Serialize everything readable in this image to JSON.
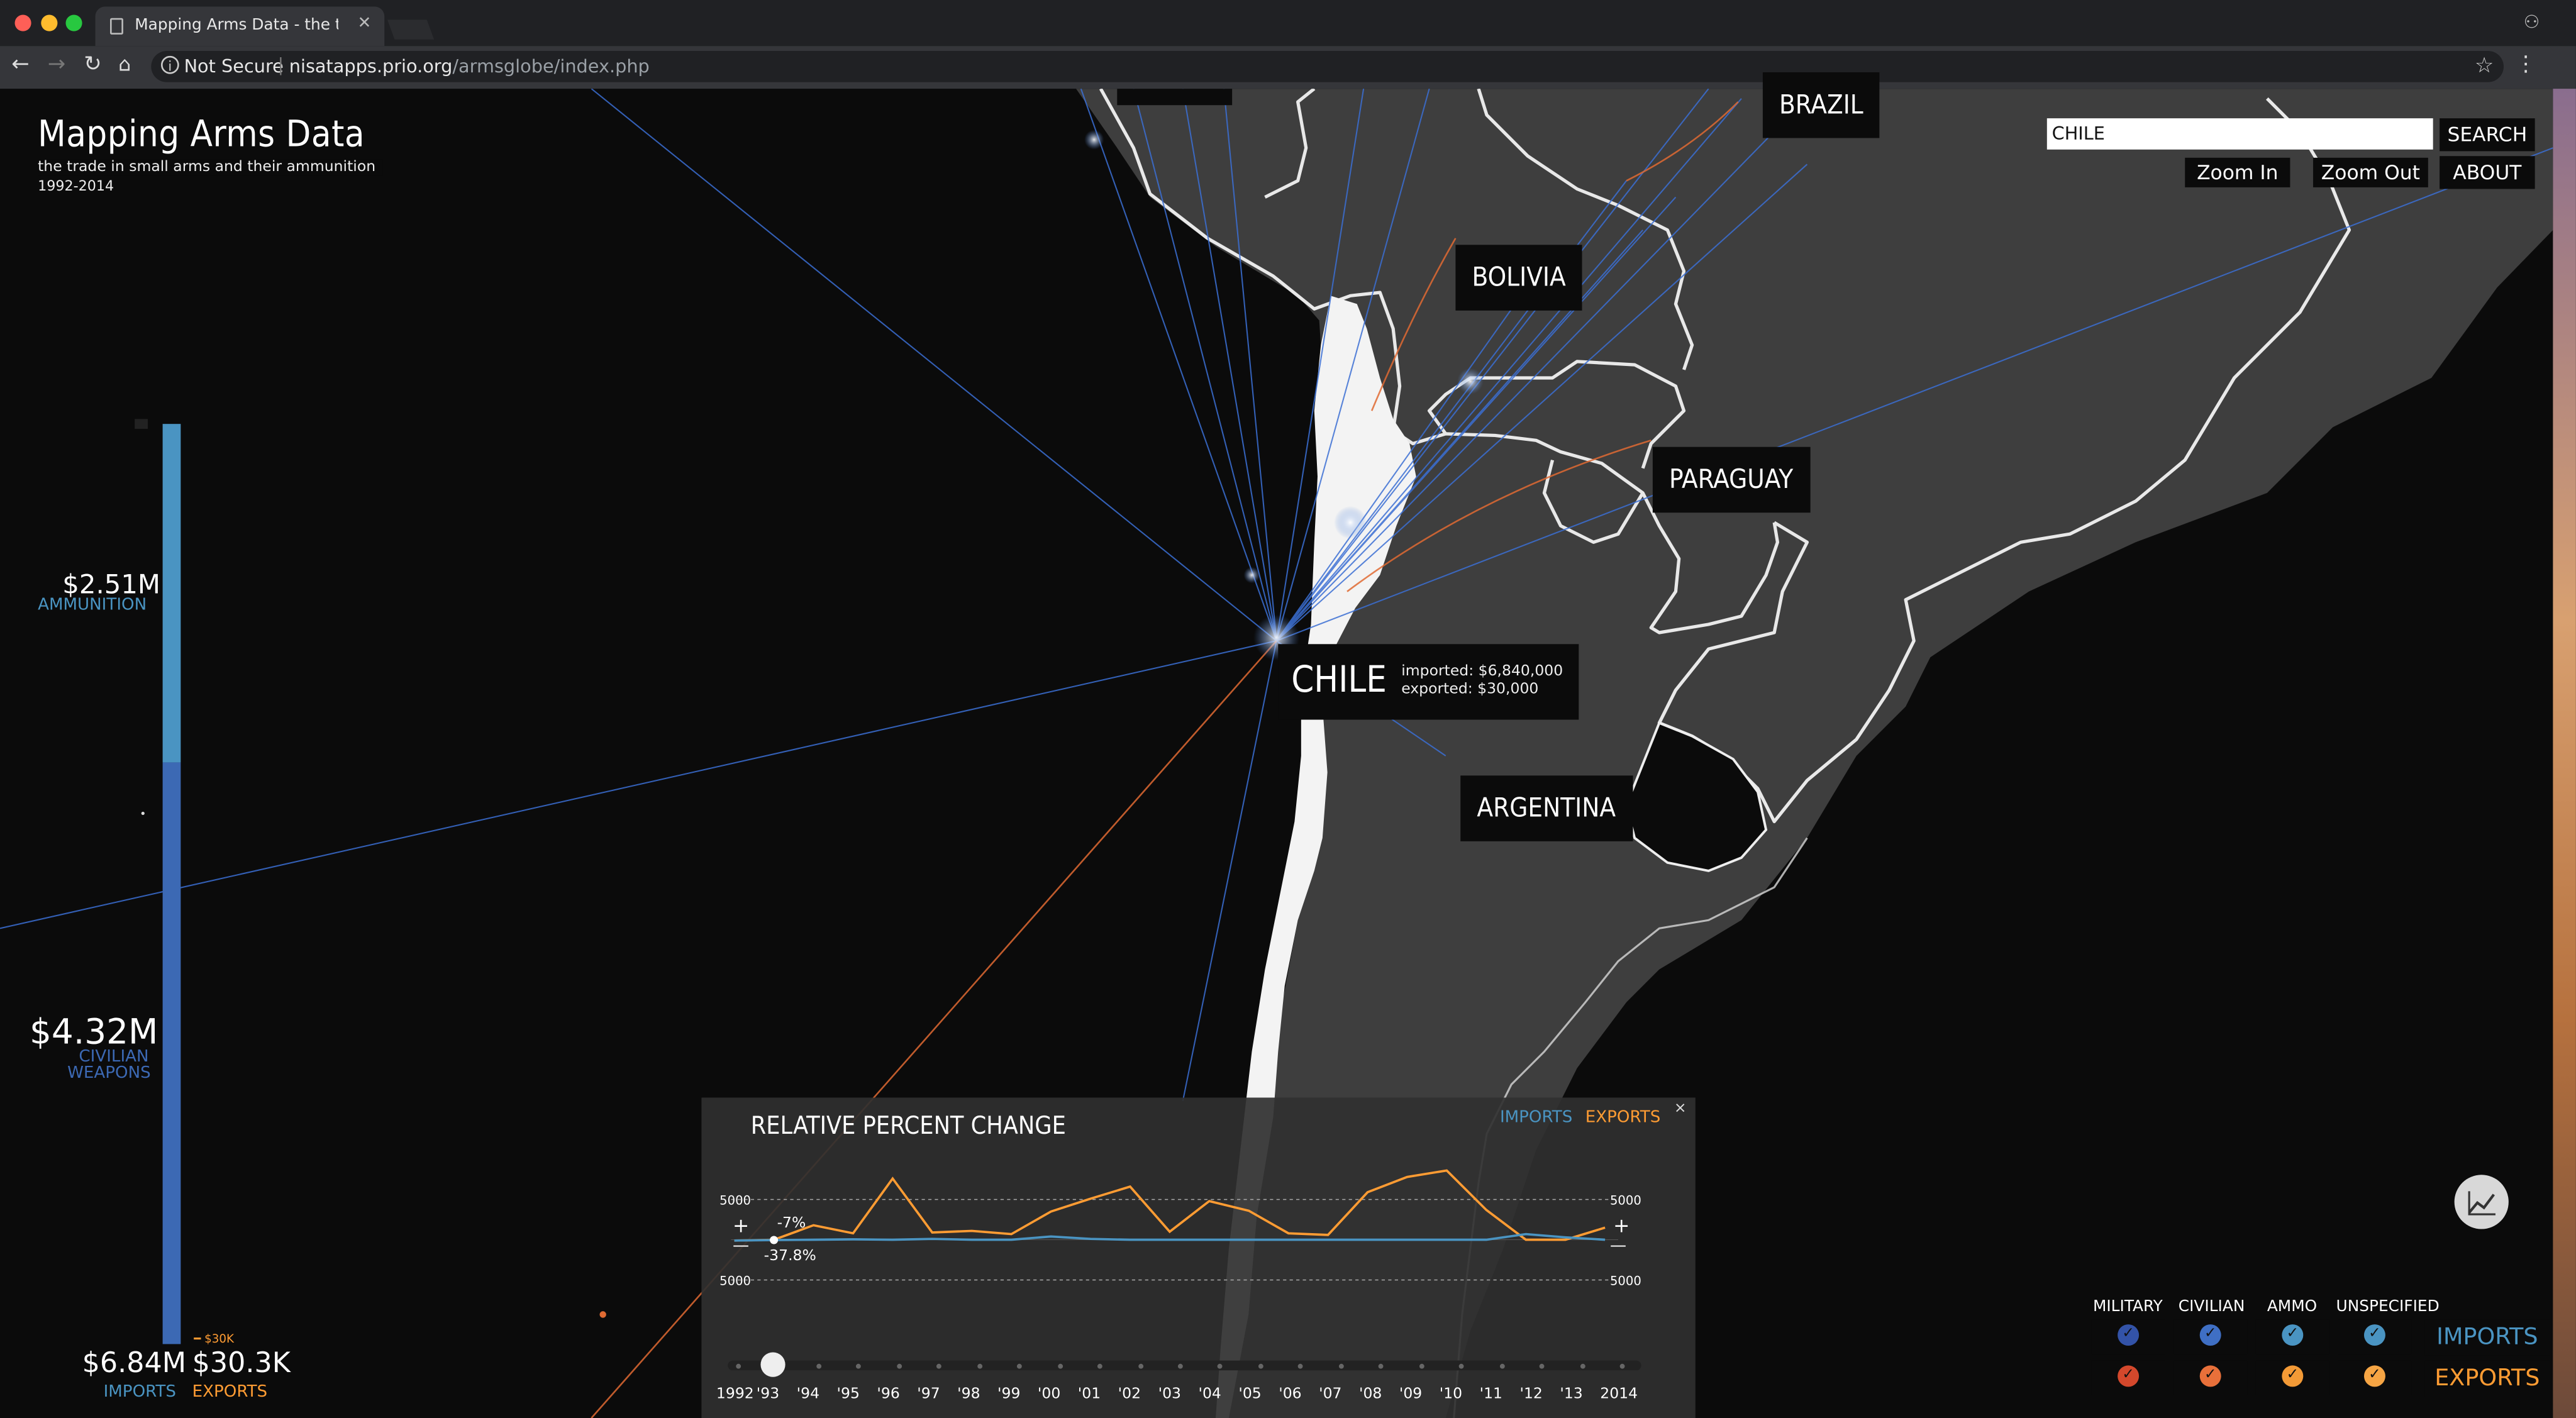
{
  "browser": {
    "tab_title": "Mapping Arms Data - the trad",
    "not_secure": "Not Secure",
    "url_host": "nisatapps.prio.org",
    "url_path": "/armsglobe/index.php"
  },
  "app": {
    "title": "Mapping Arms Data",
    "subtitle": "the trade in small arms and their ammunition",
    "years": "1992-2014"
  },
  "search": {
    "value": "CHILE",
    "button": "SEARCH"
  },
  "controls": {
    "zoom_in": "Zoom In",
    "zoom_out": "Zoom Out",
    "about": "ABOUT"
  },
  "countries": {
    "brazil": "BRAZIL",
    "bolivia": "BOLIVIA",
    "paraguay": "PARAGUAY",
    "argentina": "ARGENTINA"
  },
  "selected": {
    "name": "CHILE",
    "imported": "imported: $6,840,000",
    "exported": "exported: $30,000"
  },
  "summary": {
    "ammo_value": "$2.51M",
    "ammo_label": "AMMUNITION",
    "civ_value": "$4.32M",
    "civ_label_1": "CIVILIAN",
    "civ_label_2": "WEAPONS",
    "small_value": "$30K",
    "imports_value": "$6.84M",
    "exports_value": "$30.3K",
    "imports_label": "IMPORTS",
    "exports_label": "EXPORTS",
    "ammo_share": 0.367,
    "colors": {
      "ammunition": "#4a94c2",
      "civilian": "#3c69b4",
      "exports": "#ff9c33"
    }
  },
  "chart_panel": {
    "title": "RELATIVE PERCENT CHANGE",
    "legend_imports": "IMPORTS",
    "legend_exports": "EXPORTS",
    "close": "×",
    "axis_top": "5000",
    "axis_bottom": "5000",
    "plus": "+",
    "minus": "—",
    "marker_1": "-7%",
    "marker_2": "-37.8%"
  },
  "chart_data": {
    "type": "line",
    "title": "RELATIVE PERCENT CHANGE",
    "categories": [
      "1992",
      "'93",
      "'94",
      "'95",
      "'96",
      "'97",
      "'98",
      "'99",
      "'00",
      "'01",
      "'02",
      "'03",
      "'04",
      "'05",
      "'06",
      "'07",
      "'08",
      "'09",
      "'10",
      "'11",
      "'12",
      "'13",
      "2014"
    ],
    "ylim": [
      -5000,
      5000
    ],
    "series": [
      {
        "name": "EXPORTS",
        "color": "#ff9c33",
        "values": [
          -100,
          -7,
          1800,
          800,
          7600,
          900,
          1100,
          700,
          3500,
          5100,
          6600,
          1000,
          4800,
          3600,
          800,
          600,
          5900,
          7800,
          8600,
          3700,
          0,
          0,
          1500
        ]
      },
      {
        "name": "IMPORTS",
        "color": "#4a94c2",
        "values": [
          -100,
          -37.8,
          0,
          50,
          0,
          100,
          0,
          0,
          400,
          100,
          0,
          0,
          0,
          0,
          0,
          0,
          0,
          0,
          0,
          0,
          700,
          300,
          0
        ]
      }
    ],
    "grid": true
  },
  "filters": {
    "military": "MILITARY",
    "civilian": "CIVILIAN",
    "ammo": "AMMO",
    "unspecified": "UNSPECIFIED",
    "imports_button": "IMPORTS",
    "exports_button": "EXPORTS",
    "check": "✓",
    "import_colors": [
      "#3353a8",
      "#3f6fc4",
      "#4a94c2",
      "#4a94c2"
    ],
    "export_colors": [
      "#d4482c",
      "#e8703a",
      "#f39a36",
      "#f6a544"
    ]
  }
}
